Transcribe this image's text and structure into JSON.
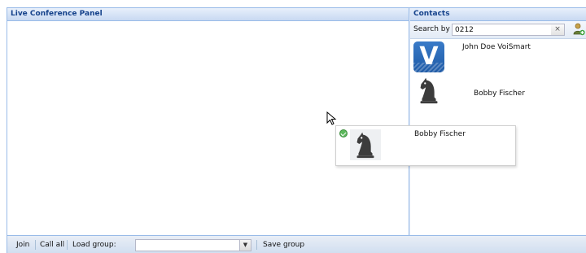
{
  "conference_panel": {
    "title": "Live Conference Panel"
  },
  "contacts_panel": {
    "title": "Contacts",
    "search": {
      "label": "Search by",
      "value": "0212",
      "clear_glyph": "×"
    },
    "contacts": [
      {
        "name": "John Doe VoiSmart",
        "avatar_icon": "voismart-v-logo-icon",
        "avatar_letter": "V"
      },
      {
        "name": "Bobby Fischer",
        "avatar_icon": "chess-knight-icon"
      }
    ]
  },
  "drag_proxy": {
    "name": "Bobby Fischer",
    "status_icon": "online-check-icon",
    "avatar_icon": "chess-knight-icon"
  },
  "toolbar": {
    "join_label": "Join",
    "call_all_label": "Call all",
    "load_group_label": "Load group:",
    "group_select_value": "",
    "save_group_label": "Save group"
  },
  "colors": {
    "header_text": "#15428b",
    "border": "#99bbe8",
    "status_online": "#5cb85c",
    "logo_blue": "#2a6bbf"
  }
}
